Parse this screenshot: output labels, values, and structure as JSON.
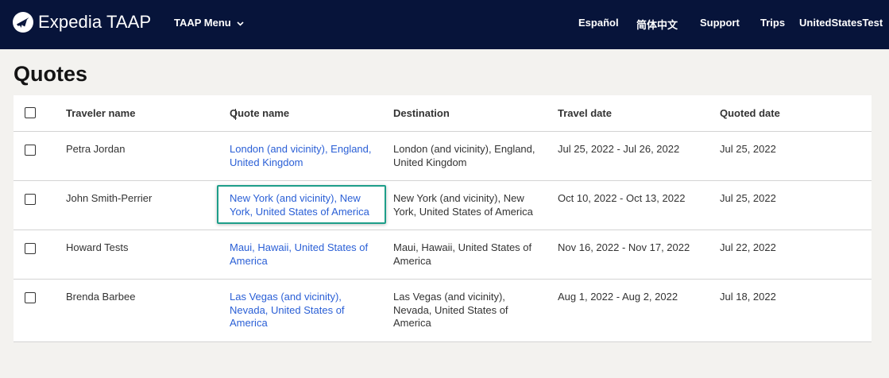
{
  "header": {
    "brand": "Expedia TAAP",
    "menu_label": "TAAP Menu",
    "nav": [
      "Español",
      "简体中文",
      "Support",
      "Trips",
      "UnitedStatesTest"
    ]
  },
  "page_title": "Quotes",
  "table": {
    "columns": [
      "Traveler name",
      "Quote name",
      "Destination",
      "Travel date",
      "Quoted date"
    ],
    "rows": [
      {
        "traveler": "Petra Jordan",
        "quote_name": "London (and vicinity), England, United Kingdom",
        "destination": "London (and vicinity), England, United Kingdom",
        "travel_date": "Jul 25, 2022 - Jul 26, 2022",
        "quoted_date": "Jul 25, 2022"
      },
      {
        "traveler": "John Smith-Perrier",
        "quote_name": "New York (and vicinity), New York, United States of America",
        "destination": "New York (and vicinity), New York, United States of America",
        "travel_date": "Oct 10, 2022 - Oct 13, 2022",
        "quoted_date": "Jul 25, 2022"
      },
      {
        "traveler": "Howard Tests",
        "quote_name": "Maui, Hawaii, United States of America",
        "destination": "Maui, Hawaii, United States of America",
        "travel_date": "Nov 16, 2022 - Nov 17, 2022",
        "quoted_date": "Jul 22, 2022"
      },
      {
        "traveler": "Brenda Barbee",
        "quote_name": "Las Vegas (and vicinity), Nevada, United States of America",
        "destination": "Las Vegas (and vicinity), Nevada, United States of America",
        "travel_date": "Aug 1, 2022 - Aug 2, 2022",
        "quoted_date": "Jul 18, 2022"
      }
    ]
  },
  "icons": {
    "logo": "expedia-plane-icon",
    "menu": "chevron-down-icon"
  },
  "colors": {
    "topbar": "#07143a",
    "link": "#2a5fd6",
    "highlight": "#1d9e89",
    "page_bg": "#f3f2ef"
  }
}
